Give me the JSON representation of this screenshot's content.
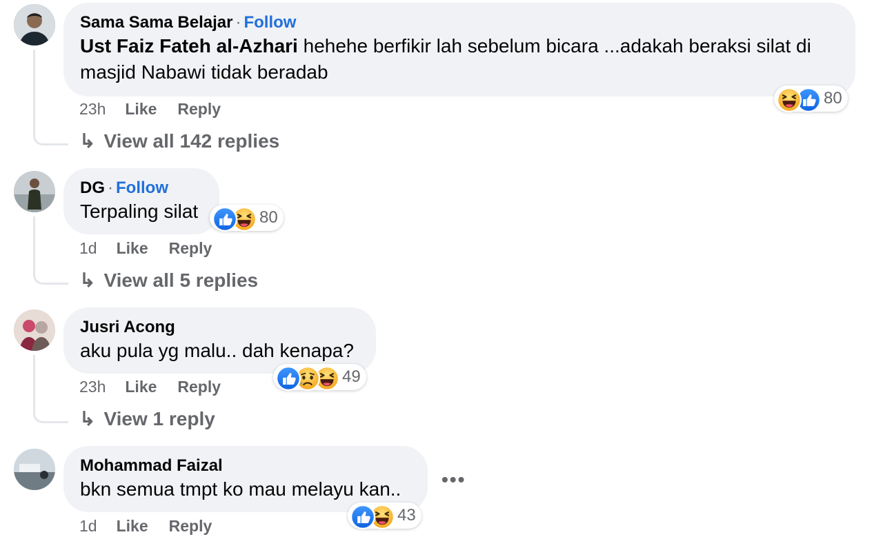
{
  "comments": [
    {
      "author": "Sama Sama Belajar",
      "follow_label": "Follow",
      "mention": "Ust Faiz Fateh al-Azhari",
      "text": "hehehe berfikir lah sebelum bicara ...adakah beraksi silat di masjid Nabawi tidak beradab",
      "reaction_count": "80",
      "reactions": [
        "haha-icon",
        "like-icon"
      ],
      "time": "23h",
      "like_label": "Like",
      "reply_label": "Reply",
      "view_replies": "View all 142 replies"
    },
    {
      "author": "DG",
      "follow_label": "Follow",
      "text": "Terpaling silat",
      "reaction_count": "80",
      "reactions": [
        "like-icon",
        "haha-icon"
      ],
      "time": "1d",
      "like_label": "Like",
      "reply_label": "Reply",
      "view_replies": "View all 5 replies"
    },
    {
      "author": "Jusri Acong",
      "text": "aku pula yg malu.. dah kenapa?",
      "reaction_count": "49",
      "reactions": [
        "like-icon",
        "sad-icon",
        "haha-icon"
      ],
      "time": "23h",
      "like_label": "Like",
      "reply_label": "Reply",
      "view_replies": "View 1 reply"
    },
    {
      "author": "Mohammad Faizal",
      "text": "bkn semua tmpt ko mau melayu kan..",
      "reaction_count": "43",
      "reactions": [
        "like-icon",
        "haha-icon"
      ],
      "time": "1d",
      "like_label": "Like",
      "reply_label": "Reply",
      "more_label": "•••"
    }
  ],
  "separator": "·",
  "reply_arrow": "↳",
  "colors": {
    "bubble": "#f0f2f5",
    "follow_link": "#216fdb",
    "meta_text": "#65676b",
    "like_blue": "#1b74e4",
    "haha_yellow": "#f7b928"
  }
}
